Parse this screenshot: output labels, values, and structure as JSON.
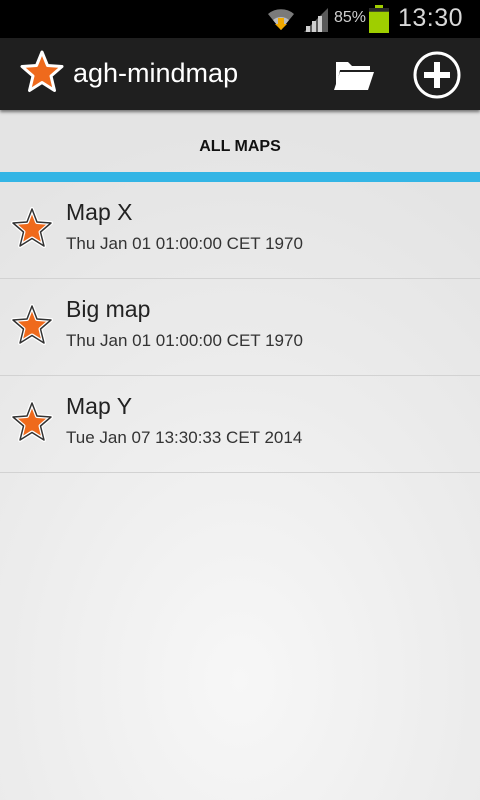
{
  "status_bar": {
    "battery_percent": "85%",
    "battery_level": 0.85,
    "time": "13:30",
    "battery_color": "#9fce00"
  },
  "action_bar": {
    "title": "agh-mindmap",
    "app_icon": "star-icon",
    "actions": [
      {
        "icon": "folder-open-icon"
      },
      {
        "icon": "add-circle-icon"
      }
    ]
  },
  "tabs": [
    {
      "label": "ALL MAPS",
      "selected": true
    }
  ],
  "colors": {
    "accent": "#33b5e5",
    "star_fill": "#ef6a1c",
    "action_bar": "#1f1f1f"
  },
  "maps": [
    {
      "name": "Map X",
      "date": "Thu Jan 01 01:00:00 CET 1970"
    },
    {
      "name": "Big map",
      "date": "Thu Jan 01 01:00:00 CET 1970"
    },
    {
      "name": "Map Y",
      "date": "Tue Jan 07 13:30:33 CET 2014"
    }
  ]
}
